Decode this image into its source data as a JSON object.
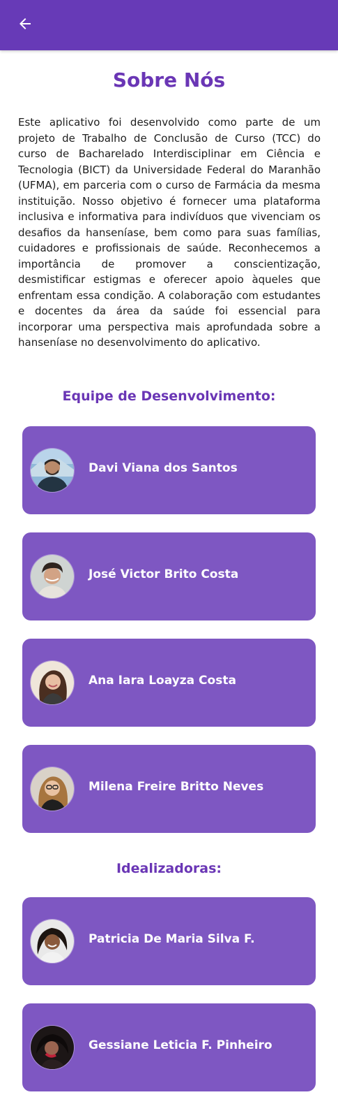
{
  "app_bar": {
    "back_icon": "arrow-left-icon",
    "color": "#673ab7"
  },
  "page": {
    "title": "Sobre Nós",
    "intro": "Este aplicativo foi desenvolvido como parte de um projeto de Trabalho de Conclusão de Curso (TCC) do curso de Bacharelado Interdisciplinar em Ciência e Tecnologia (BICT) da Universidade Federal do Maranhão (UFMA), em parceria com o curso de Farmácia da mesma instituição. Nosso objetivo é fornecer uma plataforma inclusiva e informativa para indivíduos que vivenciam os desafios da hanseníase, bem como para suas famílias, cuidadores e profissionais de saúde. Reconhecemos a importância de promover a conscientização, desmistificar estigmas e oferecer apoio àqueles que enfrentam essa condição. A colaboração com estudantes e docentes da área da saúde foi essencial para incorporar uma perspectiva mais aprofundada sobre a hanseníase no desenvolvimento do aplicativo."
  },
  "development_team": {
    "heading": "Equipe de Desenvolvimento:",
    "members": [
      {
        "name": "Davi Viana dos Santos"
      },
      {
        "name": "José Victor Brito Costa"
      },
      {
        "name": "Ana Iara Loayza Costa"
      },
      {
        "name": "Milena Freire Britto Neves"
      }
    ]
  },
  "idealizers": {
    "heading": "Idealizadoras:",
    "members": [
      {
        "name": "Patricia De Maria Silva F."
      },
      {
        "name": "Gessiane Leticia F. Pinheiro"
      }
    ]
  },
  "colors": {
    "primary": "#673ab7",
    "card": "#7e57c2",
    "heading": "#6a36b5",
    "text": "#1e1e1e"
  }
}
